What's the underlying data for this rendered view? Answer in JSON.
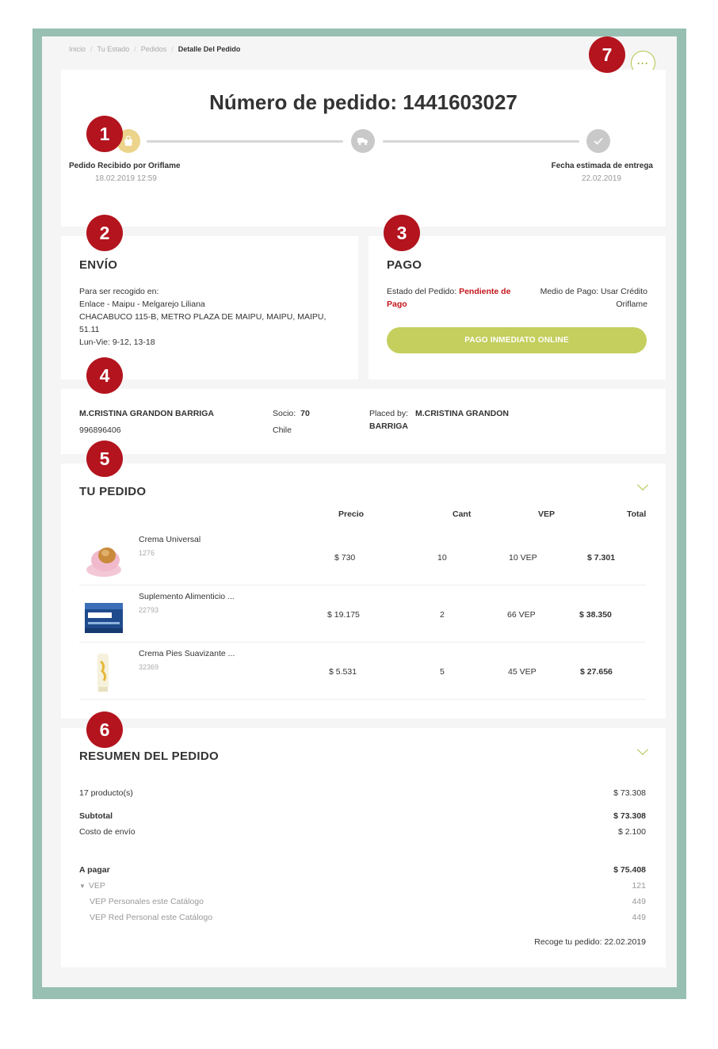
{
  "breadcrumb": [
    "Inicio",
    "Tu Estado",
    "Pedidos",
    "Detalle Del Pedido"
  ],
  "more_button": "···",
  "markers": [
    "1",
    "2",
    "3",
    "4",
    "5",
    "6",
    "7"
  ],
  "order": {
    "title": "Número de pedido: 1441603027",
    "step_received_label": "Pedido Recibido por Oriflame",
    "step_received_date": "18.02.2019 12:59",
    "step_delivery_label": "Fecha estimada de entrega",
    "step_delivery_date": "22.02.2019"
  },
  "shipping": {
    "title": "ENVÍO",
    "lines": [
      "Para ser recogido en:",
      "Enlace - Maipu - Melgarejo Liliana",
      "CHACABUCO 115-B, METRO PLAZA DE MAIPU, MAIPU, MAIPU,",
      "51.11",
      "Lun-Vie: 9-12, 13-18"
    ]
  },
  "payment": {
    "title": "PAGO",
    "status_label": "Estado del Pedido:",
    "status_value_1": "Pendiente de",
    "status_value_2": "Pago",
    "method_line1": "Medio de Pago: Usar Crédito",
    "method_line2": "Oriflame",
    "button": "PAGO INMEDIATO ONLINE"
  },
  "customer": {
    "name": "M.CRISTINA GRANDON BARRIGA",
    "phone": "996896406",
    "socio_label": "Socio:",
    "socio_value": "70",
    "country": "Chile",
    "placed_by_label": "Placed by:",
    "placed_by_1": "M.CRISTINA GRANDON",
    "placed_by_2": "BARRIGA"
  },
  "items_section": {
    "title": "TU PEDIDO",
    "headers": {
      "price": "Precio",
      "qty": "Cant",
      "vep": "VEP",
      "total": "Total"
    },
    "items": [
      {
        "name": "Crema Universal",
        "code": "1276",
        "price": "$ 730",
        "qty": "10",
        "vep": "10 VEP",
        "total": "$ 7.301"
      },
      {
        "name": "Suplemento Alimenticio ...",
        "code": "22793",
        "price": "$ 19.175",
        "qty": "2",
        "vep": "66 VEP",
        "total": "$ 38.350"
      },
      {
        "name": "Crema Pies Suavizante ...",
        "code": "32369",
        "price": "$ 5.531",
        "qty": "5",
        "vep": "45 VEP",
        "total": "$ 27.656"
      }
    ]
  },
  "summary": {
    "title": "RESUMEN DEL PEDIDO",
    "products_label": "17 producto(s)",
    "products_value": "$ 73.308",
    "subtotal_label": "Subtotal",
    "subtotal_value": "$ 73.308",
    "shipping_label": "Costo de envío",
    "shipping_value": "$ 2.100",
    "topay_label": "A pagar",
    "topay_value": "$ 75.408",
    "vep_label": "VEP",
    "vep_value": "121",
    "vep_personal_label": "VEP Personales este Catálogo",
    "vep_personal_value": "449",
    "vep_red_label": "VEP Red Personal este Catálogo",
    "vep_red_value": "449",
    "pickup_label": "Recoge tu pedido:",
    "pickup_value": "22.02.2019"
  },
  "colors": {
    "frame": "#97bfb2",
    "marker": "#b3141e",
    "accent": "#c4cf5e",
    "status_red": "#c4161c",
    "bag": "#ecd48b"
  }
}
